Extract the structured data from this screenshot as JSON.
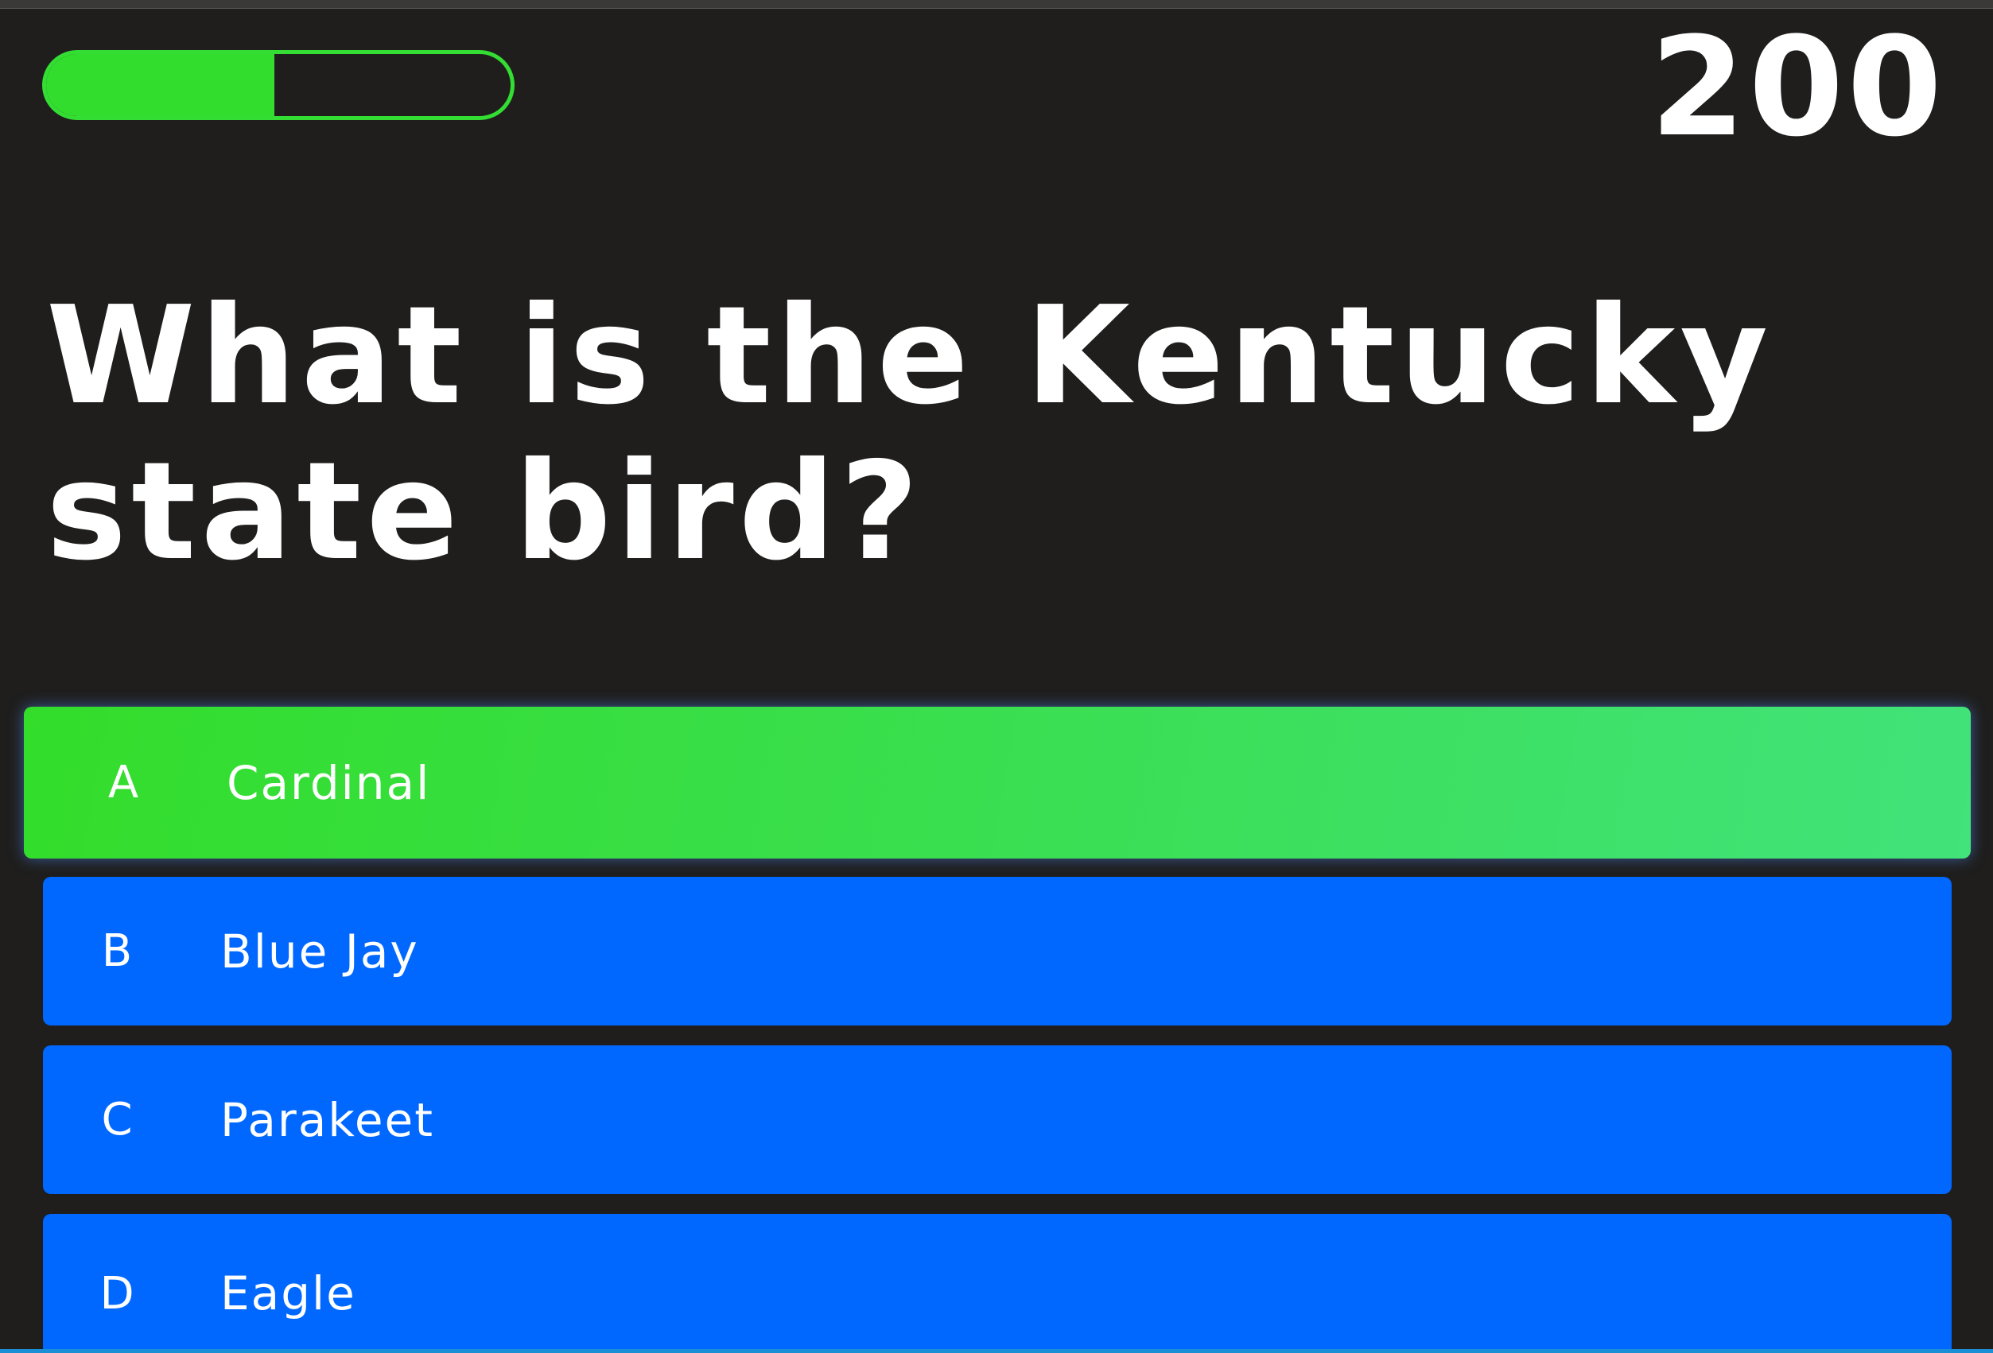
{
  "progress": {
    "fraction": 0.5,
    "color": "#33dd2e"
  },
  "score": "200",
  "question": "What is the Kentucky state bird?",
  "answers": [
    {
      "letter": "A",
      "text": "Cardinal",
      "state": "selected"
    },
    {
      "letter": "B",
      "text": "Blue Jay",
      "state": "normal"
    },
    {
      "letter": "C",
      "text": "Parakeet",
      "state": "normal"
    },
    {
      "letter": "D",
      "text": "Eagle",
      "state": "normal"
    }
  ],
  "colors": {
    "background": "#1f1e1d",
    "selected_answer": "#33dd2e",
    "answer": "#0068ff",
    "text": "#ffffff"
  }
}
